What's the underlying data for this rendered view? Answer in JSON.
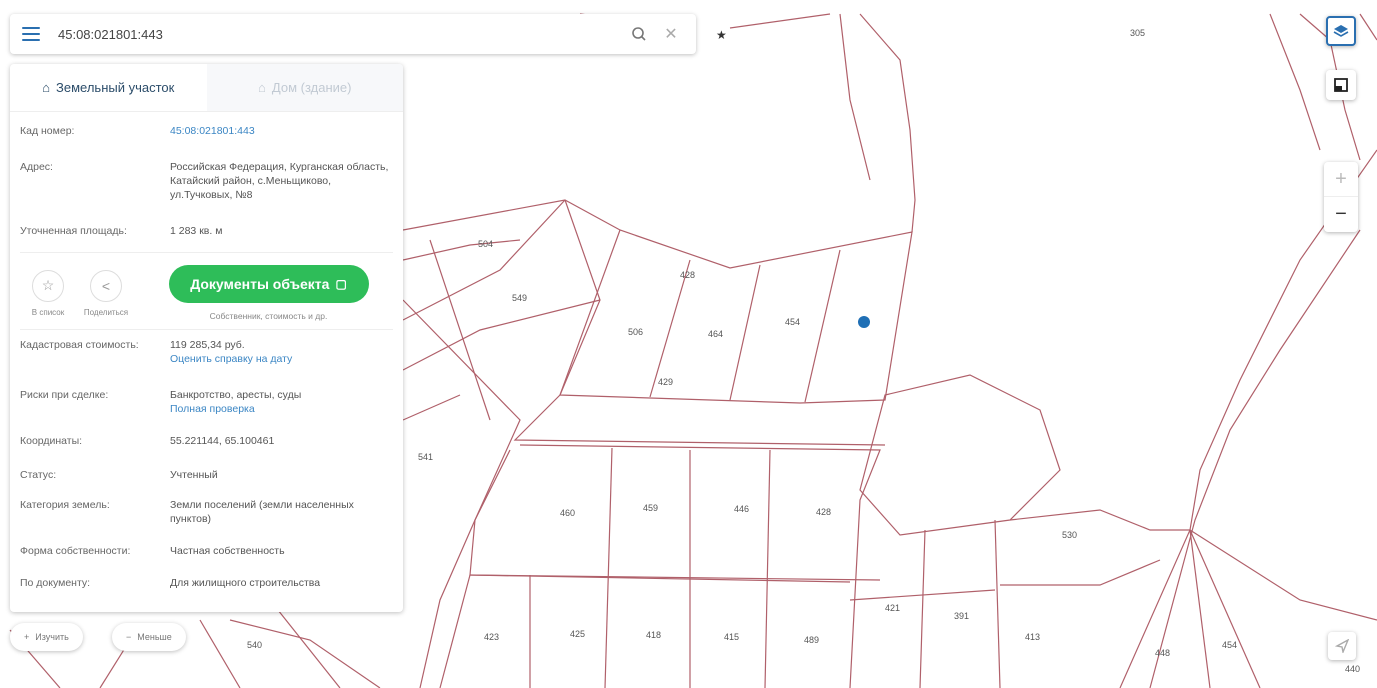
{
  "search": {
    "value": "45:08:021801:443"
  },
  "panel": {
    "tabs": [
      {
        "icon": "land-parcel-icon",
        "label": "Земельный участок"
      },
      {
        "icon": "building-icon",
        "label": "Дом (здание)"
      }
    ],
    "rows_top": [
      {
        "key": "Кад номер:",
        "value": "45:08:021801:443"
      },
      {
        "key": "Адрес:",
        "value": "Российская Федерация, Курганская область, Катайский район, с.Меньщиково, ул.Тучковых, №8"
      },
      {
        "key": "Уточненная площадь:",
        "value": "1 283 кв. м"
      }
    ],
    "actions": [
      {
        "icon": "star-icon",
        "label": "В список"
      },
      {
        "icon": "share-icon",
        "label": "Поделиться"
      }
    ],
    "docs_button": "Документы объекта",
    "docs_subtitle": "Собственник, стоимость и др.",
    "cadastral_value": {
      "key": "Кадастровая стоимость:",
      "value": "119 285,34 руб.",
      "link": "Оценить справку на дату"
    },
    "risk": {
      "key": "Риски при сделке:",
      "value": "Банкротство, аресты, суды",
      "link": "Полная проверка"
    },
    "rows_bottom": [
      {
        "key": "Координаты:",
        "value": "55.221144, 65.100461"
      },
      {
        "key": "Статус:",
        "value": "Учтенный"
      },
      {
        "key": "Категория земель:",
        "value": "Земли поселений (земли населенных пунктов)"
      },
      {
        "key": "Форма собственности:",
        "value": "Частная собственность"
      },
      {
        "key": "По документу:",
        "value": "Для жилищного строительства"
      }
    ]
  },
  "chips": [
    {
      "icon": "plus-icon",
      "label": "Изучить"
    },
    {
      "icon": "minus-icon",
      "label": "Меньше"
    }
  ],
  "map": {
    "colors": {
      "parcel_line": "#b0606a",
      "marker": "#1f6fb5",
      "accent": "#2ebd59",
      "link": "#3b86c4"
    }
  },
  "parcel_labels": [
    "305",
    "504",
    "549",
    "506",
    "464",
    "454",
    "428",
    "429",
    "541",
    "460",
    "459",
    "446",
    "428",
    "530",
    "421",
    "391",
    "413",
    "423",
    "425",
    "418",
    "415",
    "489",
    "540",
    "448",
    "454",
    "440"
  ]
}
